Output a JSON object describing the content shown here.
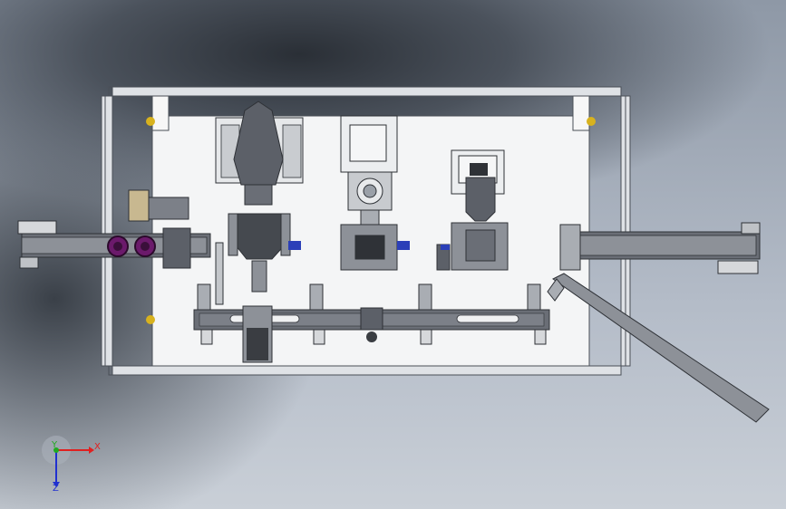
{
  "viewport": {
    "description_visible": false
  },
  "triad": {
    "x_label": "X",
    "y_label": "Y",
    "z_label": "Z",
    "x_color": "#e02020",
    "y_color": "#1faa1f",
    "z_color": "#2030d0"
  },
  "colors": {
    "frame": "#d9dde2",
    "frame_dark": "#4a4f57",
    "plate": "#f4f5f6",
    "steel": "#5c6068",
    "steel_light": "#8d9198",
    "accent_purple": "#6b1a6b",
    "accent_blue": "#2b3fb8",
    "accent_yellow": "#d8b21e"
  }
}
